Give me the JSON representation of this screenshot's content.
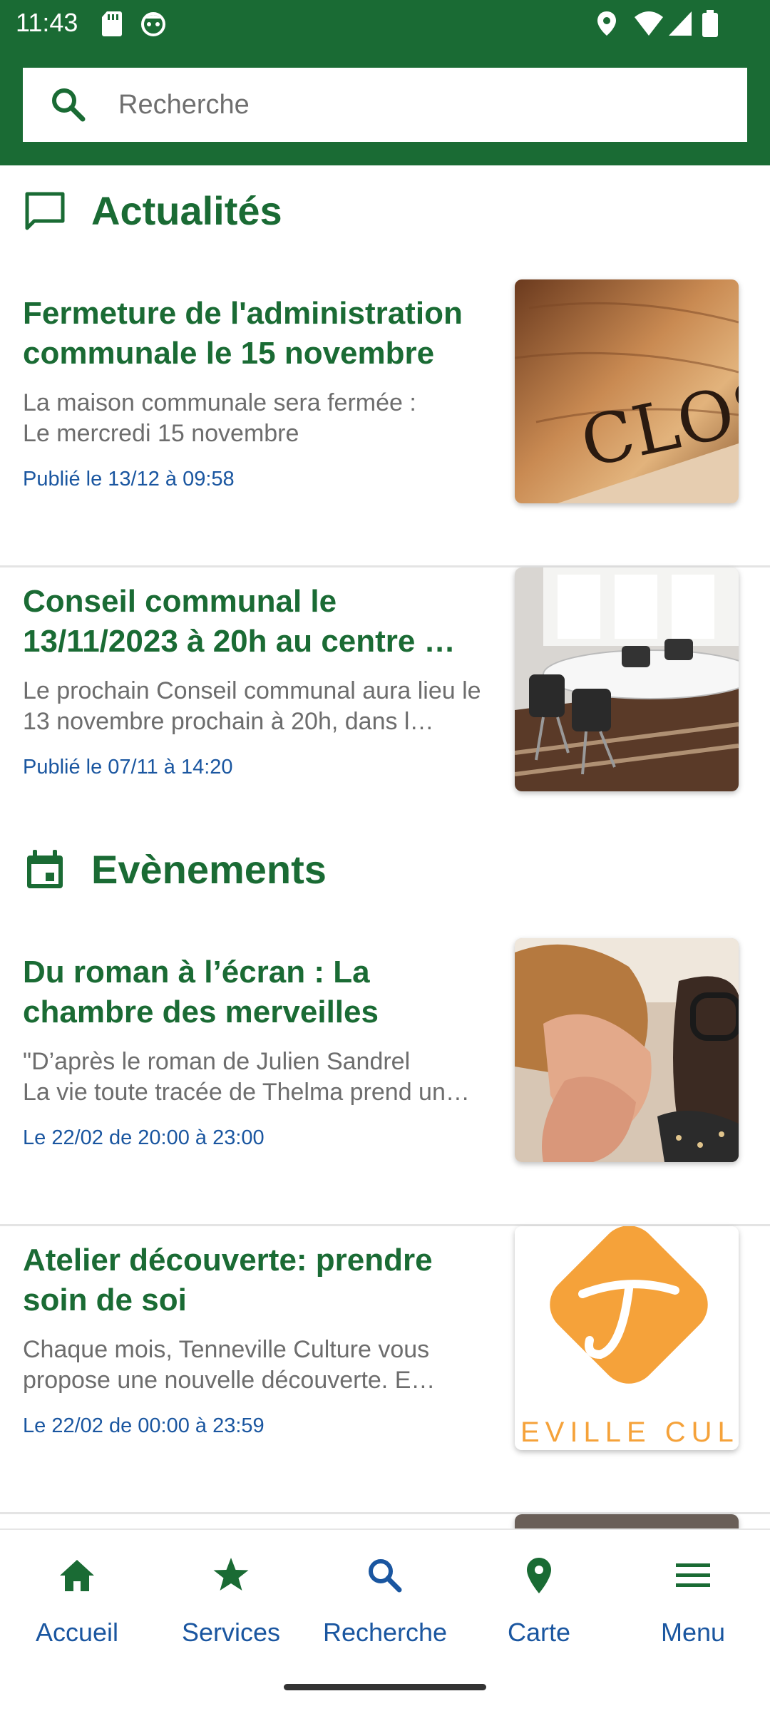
{
  "status_bar": {
    "time": "11:43"
  },
  "search": {
    "placeholder": "Recherche",
    "icon": "search-icon"
  },
  "sections": {
    "news": {
      "title": "Actualités",
      "icon": "chat-bubble-icon",
      "items": [
        {
          "title": "Fermeture de l'administration communale le 15 novembre",
          "description": "La maison communale sera fermée :\nLe mercredi 15 novembre",
          "date": "Publié le 13/12 à 09:58"
        },
        {
          "title": "Conseil communal le 13/11/2023 à 20h au centre …",
          "description": "Le prochain Conseil communal aura lieu le 13 novembre prochain à 20h, dans l…",
          "date": "Publié le 07/11 à 14:20"
        }
      ]
    },
    "events": {
      "title": "Evènements",
      "icon": "calendar-icon",
      "items": [
        {
          "title": "Du roman à l’écran : La chambre des merveilles",
          "description": "\"D’après le roman de Julien Sandrel\nLa vie toute tracée de Thelma prend un…",
          "date": "Le 22/02 de 20:00 à 23:00"
        },
        {
          "title": "Atelier découverte: prendre soin de soi",
          "description": "Chaque mois, Tenneville Culture vous propose une nouvelle découverte.     E…",
          "date": "Le 22/02 de 00:00 à 23:59",
          "logo_text": "EVILLE CUL"
        }
      ]
    }
  },
  "bottom_nav": {
    "items": [
      {
        "label": "Accueil",
        "icon": "home-icon",
        "color": "#1a6b34"
      },
      {
        "label": "Services",
        "icon": "star-icon",
        "color": "#1a6b34"
      },
      {
        "label": "Recherche",
        "icon": "search-icon",
        "color": "#1a56a0"
      },
      {
        "label": "Carte",
        "icon": "map-pin-icon",
        "color": "#1a6b34"
      },
      {
        "label": "Menu",
        "icon": "hamburger-menu-icon",
        "color": "#1a56a0"
      }
    ]
  },
  "colors": {
    "brand_green": "#1a6b34",
    "date_blue": "#1a56a0",
    "body_text": "#6d6d6d"
  }
}
